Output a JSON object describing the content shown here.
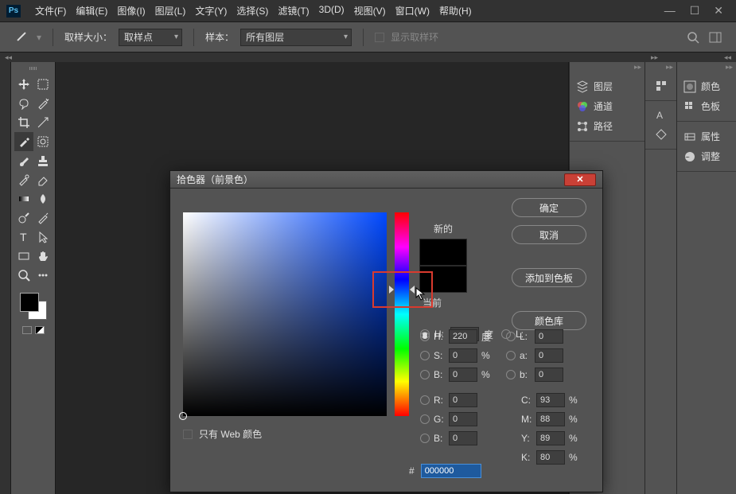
{
  "titlebar": {
    "logo": "Ps",
    "menus": [
      "文件(F)",
      "编辑(E)",
      "图像(I)",
      "图层(L)",
      "文字(Y)",
      "选择(S)",
      "滤镜(T)",
      "3D(D)",
      "视图(V)",
      "窗口(W)",
      "帮助(H)"
    ]
  },
  "options": {
    "sample_size_label": "取样大小：",
    "sample_size_value": "取样点",
    "sample_label": "样本：",
    "sample_value": "所有图层",
    "show_ring": "显示取样环"
  },
  "panels": {
    "c1": [
      "图层",
      "通道",
      "路径"
    ],
    "c3_g1": [
      "颜色",
      "色板"
    ],
    "c3_g2": [
      "属性",
      "调整"
    ]
  },
  "dialog": {
    "title": "拾色器（前景色）",
    "new_label": "新的",
    "current_label": "当前",
    "ok": "确定",
    "cancel": "取消",
    "add_swatch": "添加到色板",
    "color_lib": "颜色库",
    "web_only": "只有 Web 颜色",
    "hex_label": "#",
    "hex_value": "000000",
    "H": {
      "label": "H:",
      "value": "220",
      "unit": "度"
    },
    "S": {
      "label": "S:",
      "value": "0",
      "unit": "%"
    },
    "B": {
      "label": "B:",
      "value": "0",
      "unit": "%"
    },
    "R": {
      "label": "R:",
      "value": "0"
    },
    "G": {
      "label": "G:",
      "value": "0"
    },
    "Bb": {
      "label": "B:",
      "value": "0"
    },
    "L": {
      "label": "L:",
      "value": "0"
    },
    "a": {
      "label": "a:",
      "value": "0"
    },
    "b": {
      "label": "b:",
      "value": "0"
    },
    "C": {
      "label": "C:",
      "value": "93",
      "unit": "%"
    },
    "M": {
      "label": "M:",
      "value": "88",
      "unit": "%"
    },
    "Y": {
      "label": "Y:",
      "value": "89",
      "unit": "%"
    },
    "K": {
      "label": "K:",
      "value": "80",
      "unit": "%"
    }
  }
}
